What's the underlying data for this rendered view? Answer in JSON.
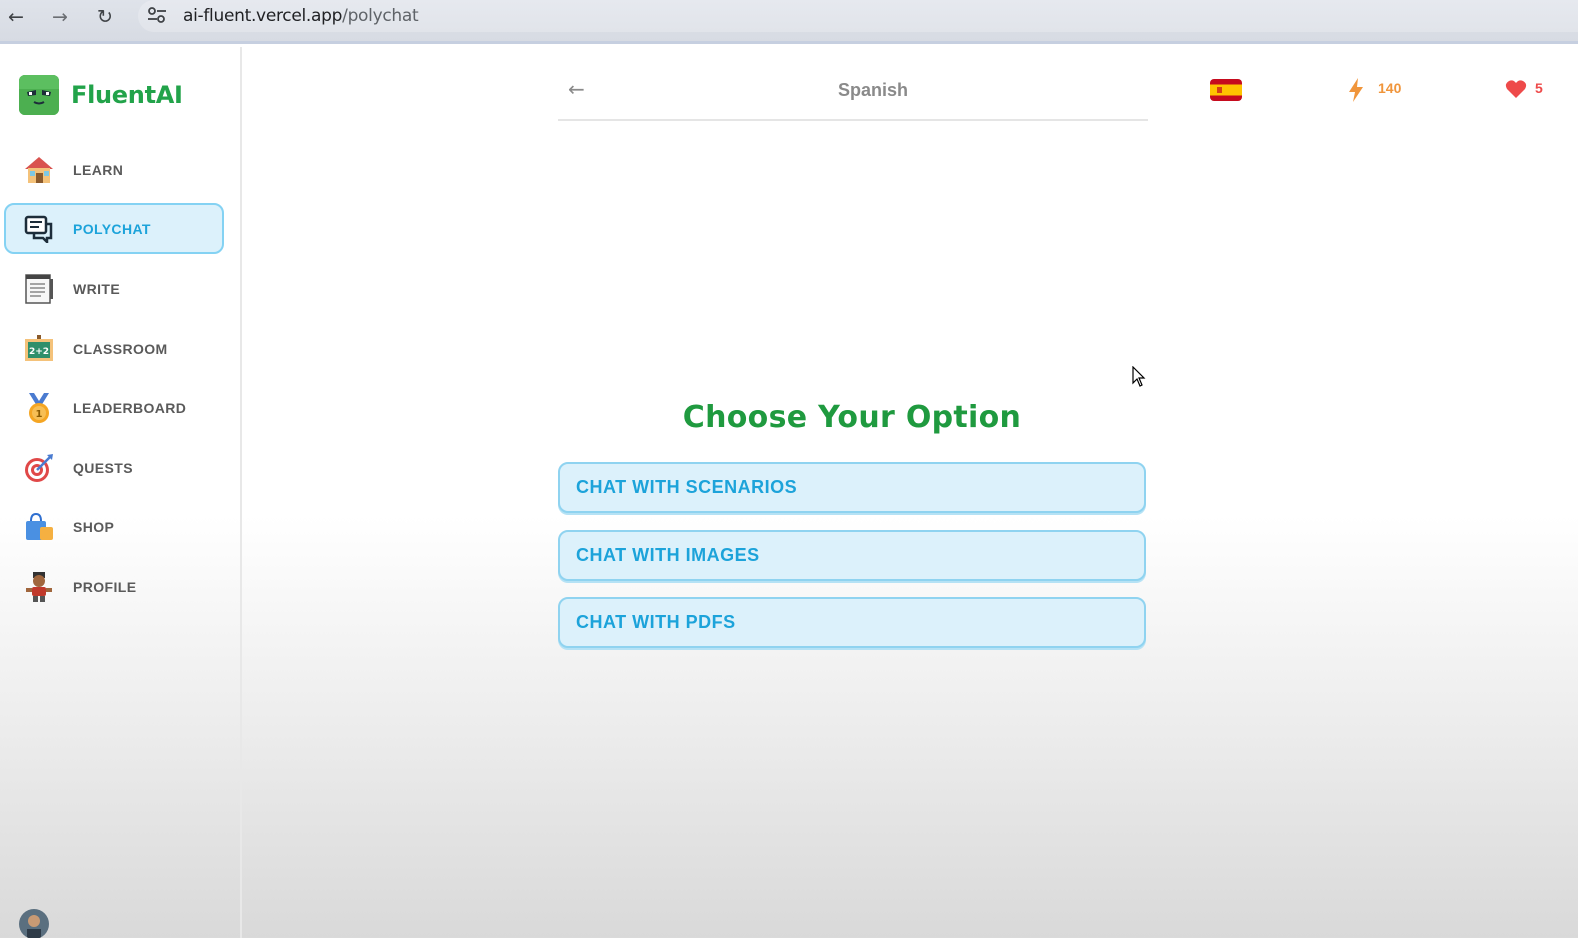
{
  "browser": {
    "url_host": "ai-fluent.vercel.app",
    "url_path": "/polychat"
  },
  "sidebar": {
    "brand": "FluentAI",
    "active_item": "POLYCHAT",
    "items": [
      {
        "label": "LEARN",
        "icon": "house-icon"
      },
      {
        "label": "POLYCHAT",
        "icon": "chat-bubbles-icon"
      },
      {
        "label": "WRITE",
        "icon": "notepad-icon"
      },
      {
        "label": "CLASSROOM",
        "icon": "chalkboard-icon"
      },
      {
        "label": "LEADERBOARD",
        "icon": "medal-icon"
      },
      {
        "label": "QUESTS",
        "icon": "target-icon"
      },
      {
        "label": "SHOP",
        "icon": "shopping-bag-icon"
      },
      {
        "label": "PROFILE",
        "icon": "profile-character-icon"
      }
    ]
  },
  "header": {
    "language": "Spanish",
    "flag": "spain-flag-icon",
    "xp": "140",
    "hearts": "5"
  },
  "main": {
    "title": "Choose Your Option",
    "options": [
      "CHAT WITH SCENARIOS",
      "CHAT WITH IMAGES",
      "CHAT WITH PDFS"
    ]
  },
  "colors": {
    "brand_green": "#22a34a",
    "accent_blue": "#1ca3da",
    "active_bg": "#dcf1fb",
    "xp_orange": "#f0953b",
    "heart_red": "#ee4a4a"
  }
}
